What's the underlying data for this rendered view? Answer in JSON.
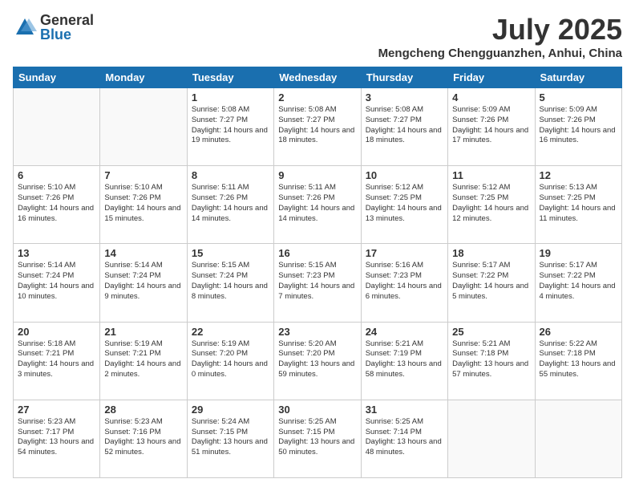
{
  "logo": {
    "general": "General",
    "blue": "Blue"
  },
  "title": {
    "month_year": "July 2025",
    "location": "Mengcheng Chengguanzhen, Anhui, China"
  },
  "days": [
    "Sunday",
    "Monday",
    "Tuesday",
    "Wednesday",
    "Thursday",
    "Friday",
    "Saturday"
  ],
  "weeks": [
    [
      {
        "day": "",
        "info": ""
      },
      {
        "day": "",
        "info": ""
      },
      {
        "day": "1",
        "info": "Sunrise: 5:08 AM\nSunset: 7:27 PM\nDaylight: 14 hours and 19 minutes."
      },
      {
        "day": "2",
        "info": "Sunrise: 5:08 AM\nSunset: 7:27 PM\nDaylight: 14 hours and 18 minutes."
      },
      {
        "day": "3",
        "info": "Sunrise: 5:08 AM\nSunset: 7:27 PM\nDaylight: 14 hours and 18 minutes."
      },
      {
        "day": "4",
        "info": "Sunrise: 5:09 AM\nSunset: 7:26 PM\nDaylight: 14 hours and 17 minutes."
      },
      {
        "day": "5",
        "info": "Sunrise: 5:09 AM\nSunset: 7:26 PM\nDaylight: 14 hours and 16 minutes."
      }
    ],
    [
      {
        "day": "6",
        "info": "Sunrise: 5:10 AM\nSunset: 7:26 PM\nDaylight: 14 hours and 16 minutes."
      },
      {
        "day": "7",
        "info": "Sunrise: 5:10 AM\nSunset: 7:26 PM\nDaylight: 14 hours and 15 minutes."
      },
      {
        "day": "8",
        "info": "Sunrise: 5:11 AM\nSunset: 7:26 PM\nDaylight: 14 hours and 14 minutes."
      },
      {
        "day": "9",
        "info": "Sunrise: 5:11 AM\nSunset: 7:26 PM\nDaylight: 14 hours and 14 minutes."
      },
      {
        "day": "10",
        "info": "Sunrise: 5:12 AM\nSunset: 7:25 PM\nDaylight: 14 hours and 13 minutes."
      },
      {
        "day": "11",
        "info": "Sunrise: 5:12 AM\nSunset: 7:25 PM\nDaylight: 14 hours and 12 minutes."
      },
      {
        "day": "12",
        "info": "Sunrise: 5:13 AM\nSunset: 7:25 PM\nDaylight: 14 hours and 11 minutes."
      }
    ],
    [
      {
        "day": "13",
        "info": "Sunrise: 5:14 AM\nSunset: 7:24 PM\nDaylight: 14 hours and 10 minutes."
      },
      {
        "day": "14",
        "info": "Sunrise: 5:14 AM\nSunset: 7:24 PM\nDaylight: 14 hours and 9 minutes."
      },
      {
        "day": "15",
        "info": "Sunrise: 5:15 AM\nSunset: 7:24 PM\nDaylight: 14 hours and 8 minutes."
      },
      {
        "day": "16",
        "info": "Sunrise: 5:15 AM\nSunset: 7:23 PM\nDaylight: 14 hours and 7 minutes."
      },
      {
        "day": "17",
        "info": "Sunrise: 5:16 AM\nSunset: 7:23 PM\nDaylight: 14 hours and 6 minutes."
      },
      {
        "day": "18",
        "info": "Sunrise: 5:17 AM\nSunset: 7:22 PM\nDaylight: 14 hours and 5 minutes."
      },
      {
        "day": "19",
        "info": "Sunrise: 5:17 AM\nSunset: 7:22 PM\nDaylight: 14 hours and 4 minutes."
      }
    ],
    [
      {
        "day": "20",
        "info": "Sunrise: 5:18 AM\nSunset: 7:21 PM\nDaylight: 14 hours and 3 minutes."
      },
      {
        "day": "21",
        "info": "Sunrise: 5:19 AM\nSunset: 7:21 PM\nDaylight: 14 hours and 2 minutes."
      },
      {
        "day": "22",
        "info": "Sunrise: 5:19 AM\nSunset: 7:20 PM\nDaylight: 14 hours and 0 minutes."
      },
      {
        "day": "23",
        "info": "Sunrise: 5:20 AM\nSunset: 7:20 PM\nDaylight: 13 hours and 59 minutes."
      },
      {
        "day": "24",
        "info": "Sunrise: 5:21 AM\nSunset: 7:19 PM\nDaylight: 13 hours and 58 minutes."
      },
      {
        "day": "25",
        "info": "Sunrise: 5:21 AM\nSunset: 7:18 PM\nDaylight: 13 hours and 57 minutes."
      },
      {
        "day": "26",
        "info": "Sunrise: 5:22 AM\nSunset: 7:18 PM\nDaylight: 13 hours and 55 minutes."
      }
    ],
    [
      {
        "day": "27",
        "info": "Sunrise: 5:23 AM\nSunset: 7:17 PM\nDaylight: 13 hours and 54 minutes."
      },
      {
        "day": "28",
        "info": "Sunrise: 5:23 AM\nSunset: 7:16 PM\nDaylight: 13 hours and 52 minutes."
      },
      {
        "day": "29",
        "info": "Sunrise: 5:24 AM\nSunset: 7:15 PM\nDaylight: 13 hours and 51 minutes."
      },
      {
        "day": "30",
        "info": "Sunrise: 5:25 AM\nSunset: 7:15 PM\nDaylight: 13 hours and 50 minutes."
      },
      {
        "day": "31",
        "info": "Sunrise: 5:25 AM\nSunset: 7:14 PM\nDaylight: 13 hours and 48 minutes."
      },
      {
        "day": "",
        "info": ""
      },
      {
        "day": "",
        "info": ""
      }
    ]
  ]
}
